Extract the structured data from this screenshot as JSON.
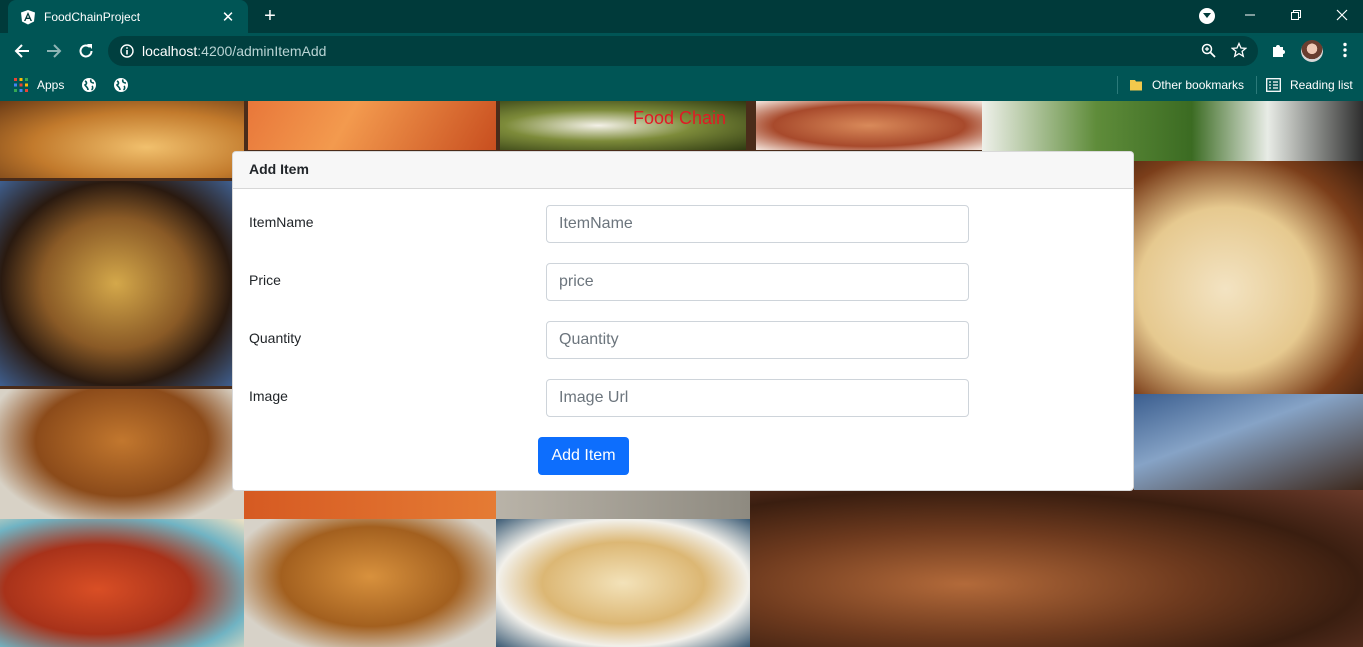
{
  "browser": {
    "tab_title": "FoodChainProject",
    "url_host": "localhost",
    "url_path": ":4200/adminItemAdd",
    "bookmarks": {
      "apps_label": "Apps",
      "other_bookmarks": "Other bookmarks",
      "reading_list": "Reading list"
    },
    "colors": {
      "frame": "#003a3a",
      "toolbar": "#005555"
    }
  },
  "page": {
    "brand_title": "Food Chain",
    "card_title": "Add Item",
    "form": {
      "fields": [
        {
          "label": "ItemName",
          "placeholder": "ItemName"
        },
        {
          "label": "Price",
          "placeholder": "price"
        },
        {
          "label": "Quantity",
          "placeholder": "Quantity"
        },
        {
          "label": "Image",
          "placeholder": "Image Url"
        }
      ],
      "submit_label": "Add Item"
    },
    "colors": {
      "brand": "#e01a25",
      "primary_button": "#0d6efd"
    }
  },
  "icons": [
    "angular-favicon-icon",
    "close-tab-icon",
    "new-tab-icon",
    "profile-dropdown-icon",
    "minimize-icon",
    "restore-icon",
    "close-window-icon",
    "back-arrow-icon",
    "forward-arrow-icon",
    "reload-icon",
    "site-info-icon",
    "zoom-icon",
    "bookmark-star-icon",
    "extensions-icon",
    "menu-dots-icon",
    "apps-grid-icon",
    "globe-icon",
    "folder-icon",
    "reading-list-icon"
  ]
}
